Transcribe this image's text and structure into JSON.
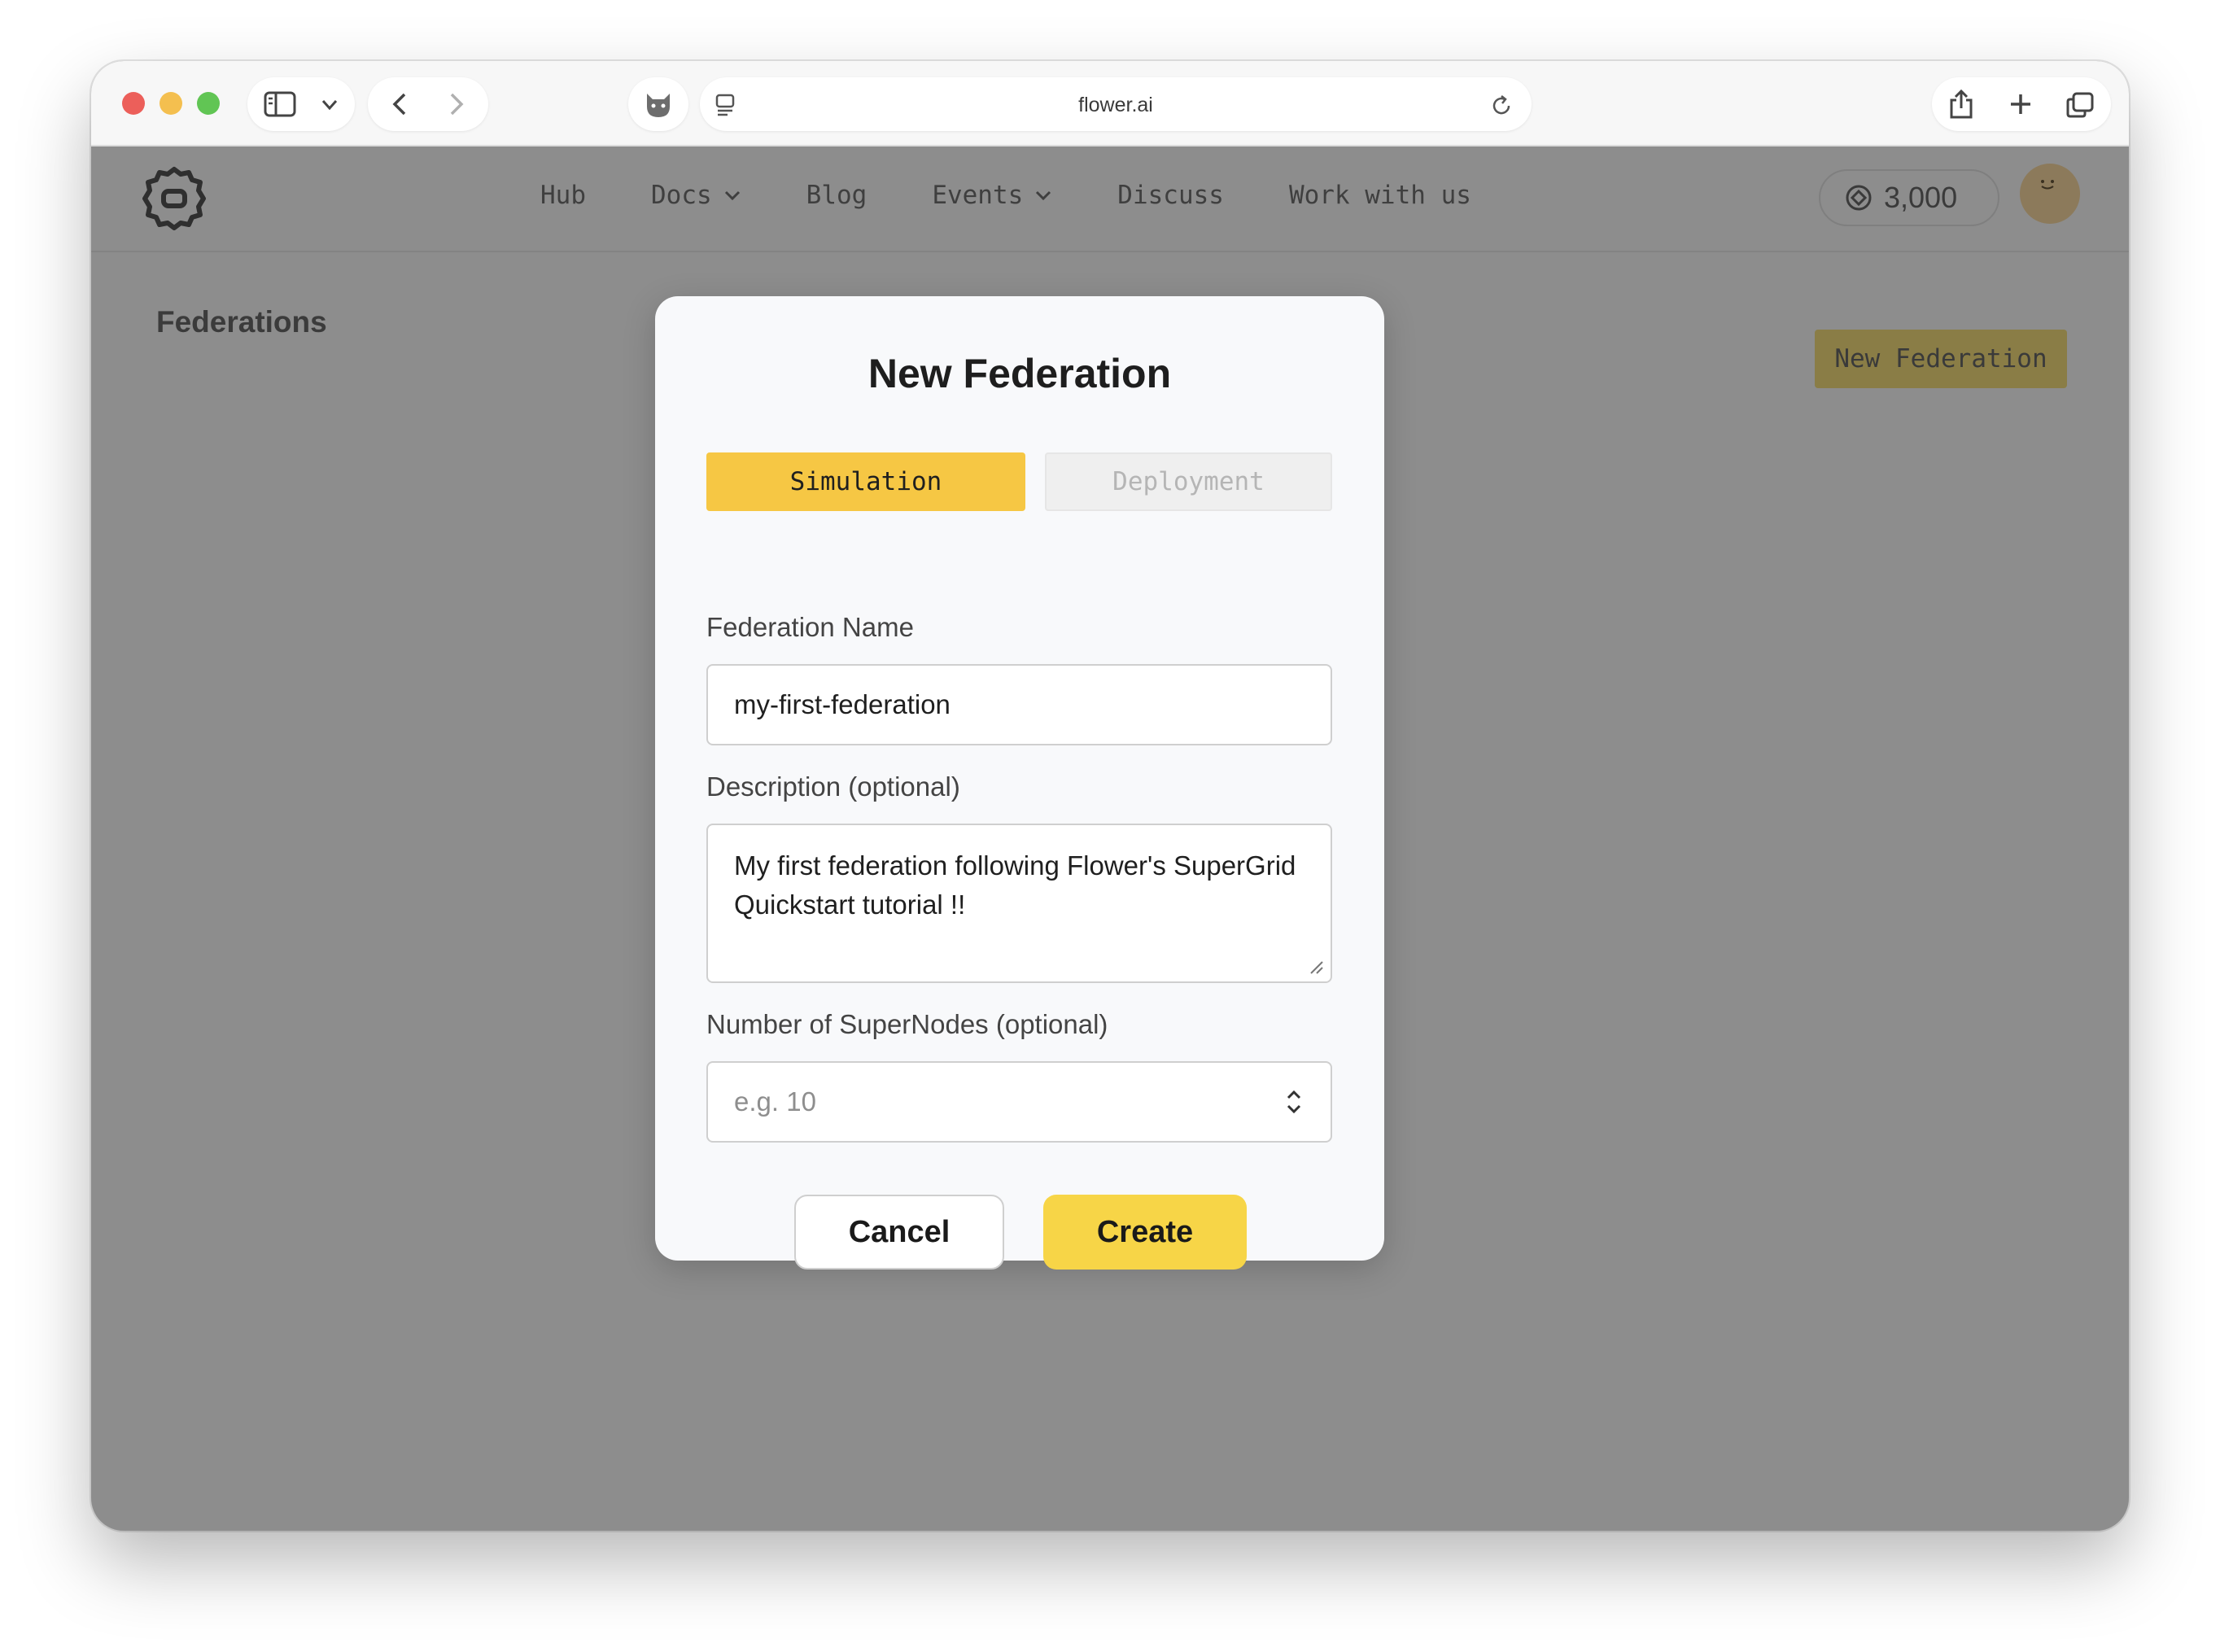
{
  "browser": {
    "url": "flower.ai"
  },
  "site": {
    "nav": [
      {
        "label": "Hub",
        "has_dropdown": false
      },
      {
        "label": "Docs",
        "has_dropdown": true
      },
      {
        "label": "Blog",
        "has_dropdown": false
      },
      {
        "label": "Events",
        "has_dropdown": true
      },
      {
        "label": "Discuss",
        "has_dropdown": false
      },
      {
        "label": "Work with us",
        "has_dropdown": false
      }
    ],
    "credits": "3,000"
  },
  "page": {
    "title": "Federations",
    "new_button": "New Federation"
  },
  "modal": {
    "title": "New Federation",
    "tabs": {
      "simulation": "Simulation",
      "deployment": "Deployment",
      "active": "Simulation"
    },
    "name_label": "Federation Name",
    "name_value": "my-first-federation",
    "description_label": "Description (optional)",
    "description_value": "My first federation following Flower's SuperGrid Quickstart tutorial !!",
    "supernodes_label": "Number of SuperNodes (optional)",
    "supernodes_placeholder": "e.g. 10",
    "cancel": "Cancel",
    "create": "Create"
  },
  "colors": {
    "accent": "#f6c744",
    "create_button": "#f7d547",
    "overlay": "#8d8d8d"
  }
}
